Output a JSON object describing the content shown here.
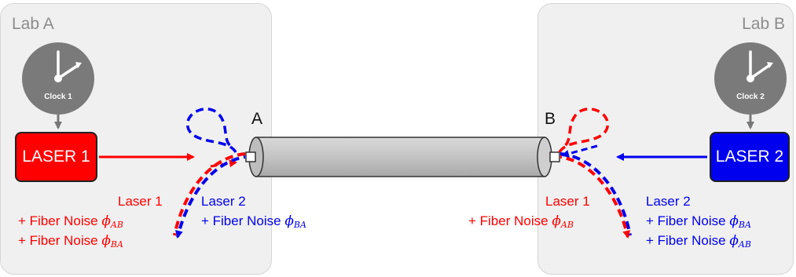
{
  "lab_a": {
    "title": "Lab A"
  },
  "lab_b": {
    "title": "Lab B"
  },
  "clock1": {
    "label": "Clock 1"
  },
  "clock2": {
    "label": "Clock 2"
  },
  "laser1": {
    "label": "LASER 1"
  },
  "laser2": {
    "label": "LASER 2"
  },
  "ports": {
    "a": "A",
    "b": "B"
  },
  "colors": {
    "laser1": "#ff0000",
    "laser2": "#0000ee",
    "clock": "#777777",
    "fiber": "#c0c0c0"
  },
  "left_texts": {
    "laser1_title": "Laser 1",
    "laser1_line1_prefix": "+ Fiber Noise",
    "laser1_line1_sub": "AB",
    "laser1_line2_prefix": "+ Fiber Noise",
    "laser1_line2_sub": "BA",
    "laser2_title": "Laser 2",
    "laser2_line1_prefix": "+ Fiber Noise",
    "laser2_line1_sub": "BA"
  },
  "right_texts": {
    "laser1_title": "Laser 1",
    "laser1_line1_prefix": "+ Fiber Noise",
    "laser1_line1_sub": "AB",
    "laser2_title": "Laser 2",
    "laser2_line1_prefix": "+ Fiber Noise",
    "laser2_line1_sub": "BA",
    "laser2_line2_prefix": "+ Fiber Noise",
    "laser2_line2_sub": "AB"
  },
  "symbols": {
    "phi": "ϕ"
  }
}
